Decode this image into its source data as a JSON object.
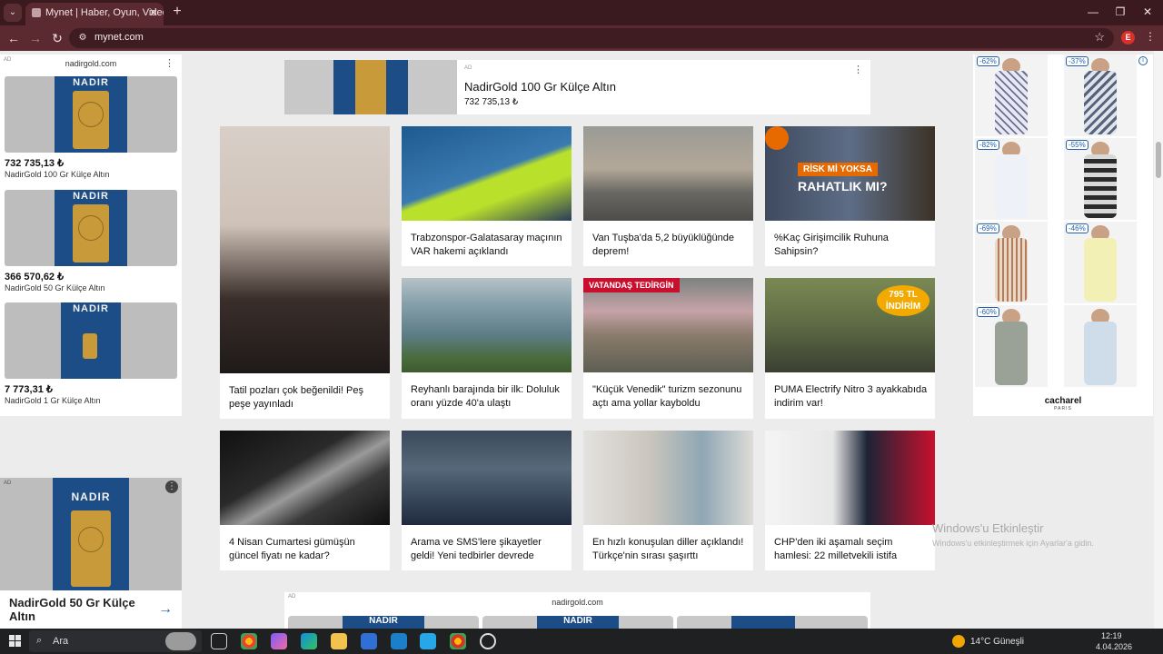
{
  "browser": {
    "tab_title": "Mynet | Haber, Oyun, Video, Sp",
    "tab_close": "✕",
    "new_tab": "+",
    "url": "mynet.com",
    "profile_initial": "E"
  },
  "left_ad": {
    "tag": "AD",
    "domain": "nadirgold.com",
    "brand": "NADIR",
    "items": [
      {
        "price": "732 735,13 ₺",
        "name": "NadirGold 100 Gr Külçe Altın"
      },
      {
        "price": "366 570,62 ₺",
        "name": "NadirGold 50 Gr Külçe Altın"
      },
      {
        "price": "7 773,31 ₺",
        "name": "NadirGold 1 Gr Külçe Altın"
      }
    ]
  },
  "left_ad2": {
    "tag": "AD",
    "brand": "NADIR",
    "title": "NadirGold 50 Gr Külçe Altın"
  },
  "top_ad": {
    "tag": "AD",
    "title": "NadirGold 100 Gr Külçe Altın",
    "price": "732 735,13 ₺"
  },
  "news": [
    {
      "title": "Tatil pozları çok beğenildi! Peş peşe yayınladı"
    },
    {
      "title": "Trabzonspor-Galatasaray maçının VAR hakemi açıklandı"
    },
    {
      "title": "Van Tuşba'da 5,2 büyüklüğünde deprem!"
    },
    {
      "title": "%Kaç Girişimcilik Ruhuna Sahipsin?",
      "overlay1": "RİSK Mİ YOKSA",
      "overlay2": "RAHATLIK MI?"
    },
    {
      "title": "Reyhanlı barajında bir ilk: Doluluk oranı yüzde 40'a ulaştı"
    },
    {
      "title": "\"Küçük Venedik\" turizm sezonunu açtı ama yollar kayboldu",
      "badge": "VATANDAŞ TEDİRGİN"
    },
    {
      "title": "PUMA Electrify Nitro 3 ayakkabıda indirim var!",
      "promo1": "795 TL",
      "promo2": "İNDİRİM"
    },
    {
      "title": "4 Nisan Cumartesi gümüşün güncel fiyatı ne kadar?"
    },
    {
      "title": "Arama ve SMS'lere şikayetler geldi! Yeni tedbirler devrede"
    },
    {
      "title": "En hızlı konuşulan diller açıklandı! Türkçe'nin sırası şaşırttı"
    },
    {
      "title": "CHP'den iki aşamalı seçim hamlesi: 22 milletvekili istifa"
    }
  ],
  "right_ad": {
    "discounts": [
      "-62%",
      "-37%",
      "-82%",
      "-55%",
      "-69%",
      "-46%",
      "-60%"
    ],
    "brand": "cacharel",
    "brand_sub": "PARIS"
  },
  "bottom_ad": {
    "tag": "AD",
    "domain": "nadirgold.com",
    "brand": "NADIR"
  },
  "watermark": {
    "title": "Windows'u Etkinleştir",
    "sub": "Windows'u etkinleştirmek için Ayarlar'a gidin."
  },
  "taskbar": {
    "search_placeholder": "Ara",
    "weather": "14°C  Güneşli",
    "time": "12:19",
    "date": "4.04.2026"
  }
}
